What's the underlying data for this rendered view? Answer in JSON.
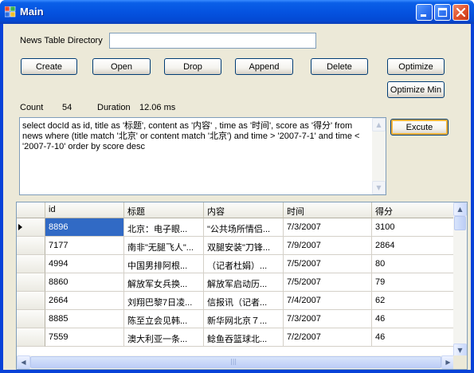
{
  "window": {
    "title": "Main",
    "accent": "#0553e0",
    "close_color": "#e0502a"
  },
  "form": {
    "directory_label": "News Table Directory",
    "directory_value": "",
    "buttons": {
      "create": "Create",
      "open": "Open",
      "drop": "Drop",
      "append": "Append",
      "delete": "Delete",
      "optimize": "Optimize",
      "optimize_min": "Optimize Min",
      "execute": "Excute"
    },
    "count_label": "Count",
    "count_value": "54",
    "duration_label": "Duration",
    "duration_value": "12.06 ms",
    "query": "select docId as id, title as '标题', content as '内容' , time as '时间', score as '得分' from news where (title match '北京' or content match '北京')  and time > '2007-7-1' and time < '2007-7-10' order by score desc"
  },
  "grid": {
    "columns": [
      "id",
      "标题",
      "内容",
      "时间",
      "得分"
    ],
    "rows": [
      {
        "id": "8896",
        "title": "北京：电子眼...",
        "content": "\"公共场所情侣...",
        "time": "7/3/2007",
        "score": "3100"
      },
      {
        "id": "7177",
        "title": "南非\"无腿飞人\"...",
        "content": "双腿安装\"刀锋...",
        "time": "7/9/2007",
        "score": "2864"
      },
      {
        "id": "4994",
        "title": "中国男排阿根...",
        "content": "（记者杜娟）...",
        "time": "7/5/2007",
        "score": "80"
      },
      {
        "id": "8860",
        "title": "解放军女兵换...",
        "content": "解放军启动历...",
        "time": "7/5/2007",
        "score": "79"
      },
      {
        "id": "2664",
        "title": "刘翔巴黎7日凌...",
        "content": "信报讯（记者...",
        "time": "7/4/2007",
        "score": "62"
      },
      {
        "id": "8885",
        "title": "陈至立会见韩...",
        "content": "新华网北京７...",
        "time": "7/3/2007",
        "score": "46"
      },
      {
        "id": "7559",
        "title": "澳大利亚一条...",
        "content": "鲶鱼吞篮球北...",
        "time": "7/2/2007",
        "score": "46"
      }
    ],
    "selected_color": "#316ac5"
  }
}
